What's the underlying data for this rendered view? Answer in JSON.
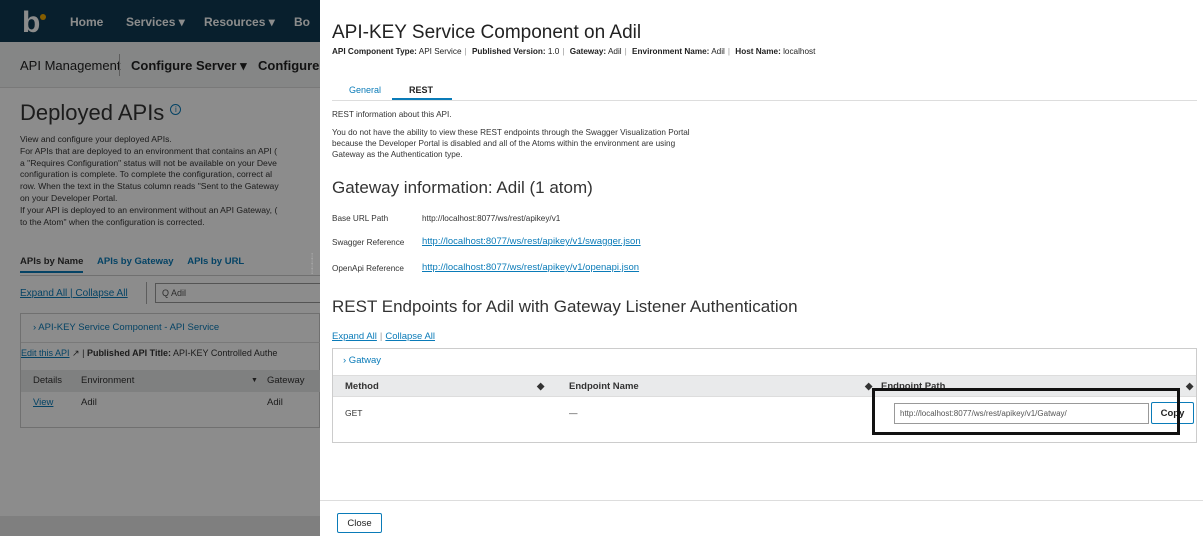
{
  "background": {
    "nav": {
      "home": "Home",
      "services": "Services ▾",
      "resources": "Resources ▾",
      "truncated": "Bo"
    },
    "subnav": {
      "api_management": "API Management",
      "configure_server": "Configure Server ▾",
      "configure": "Configure"
    },
    "title": "Deployed APIs",
    "description_lines": [
      "View and configure your deployed APIs.",
      "For APIs that are deployed to an environment that contains an API (",
      "a \"Requires Configuration\" status will not be available on your Deve",
      "configuration is complete. To complete the configuration, correct al",
      "row. When the text in the Status column reads \"Sent to the Gateway",
      "on your Developer Portal.",
      "If your API is deployed to an environment without an API Gateway, (",
      "to the Atom\" when the configuration is corrected."
    ],
    "tabs": [
      "APIs by Name",
      "APIs by Gateway",
      "APIs by URL"
    ],
    "expand_all": "Expand All",
    "collapse_all": "Collapse All",
    "search_value": "Adil",
    "card_title": "› API-KEY Service Component - API Service",
    "edit_link": "Edit this API",
    "published_label": "Published API Title:",
    "published_value": "API-KEY Controlled Authe",
    "table_headers": [
      "Details",
      "Environment",
      "Gateway"
    ],
    "table_row": [
      "View",
      "Adil",
      "Adil"
    ]
  },
  "panel": {
    "title": "API-KEY Service Component on Adil",
    "meta": [
      {
        "label": "API Component Type:",
        "value": "API Service"
      },
      {
        "label": "Published Version:",
        "value": "1.0"
      },
      {
        "label": "Gateway:",
        "value": "Adil"
      },
      {
        "label": "Environment Name:",
        "value": "Adil"
      },
      {
        "label": "Host Name:",
        "value": "localhost"
      }
    ],
    "tabs": {
      "general": "General",
      "rest": "REST"
    },
    "rest_info": "REST information about this API.",
    "notice_lines": [
      "You do not have the ability to view these REST endpoints through the Swagger Visualization Portal",
      "because the Developer Portal is disabled and all of the Atoms within the environment are using",
      "Gateway as the Authentication type."
    ],
    "gateway_heading": "Gateway information: Adil (1 atom)",
    "base_url_label": "Base URL Path",
    "base_url_value": "http://localhost:8077/ws/rest/apikey/v1",
    "swagger_label": "Swagger Reference",
    "swagger_link": "http://localhost:8077/ws/rest/apikey/v1/swagger.json",
    "openapi_label": "OpenApi Reference",
    "openapi_link": "http://localhost:8077/ws/rest/apikey/v1/openapi.json",
    "endpoints_heading": "REST Endpoints for Adil with Gateway Listener Authentication",
    "expand_all": "Expand All",
    "collapse_all": "Collapse All",
    "group_name": "› Gatway",
    "columns": [
      "Method",
      "Endpoint Name",
      "Endpoint Path"
    ],
    "row": {
      "method": "GET",
      "name": "—",
      "path": "http://localhost:8077/ws/rest/apikey/v1/Gatway/"
    },
    "copy_label": "Copy",
    "close_label": "Close"
  }
}
